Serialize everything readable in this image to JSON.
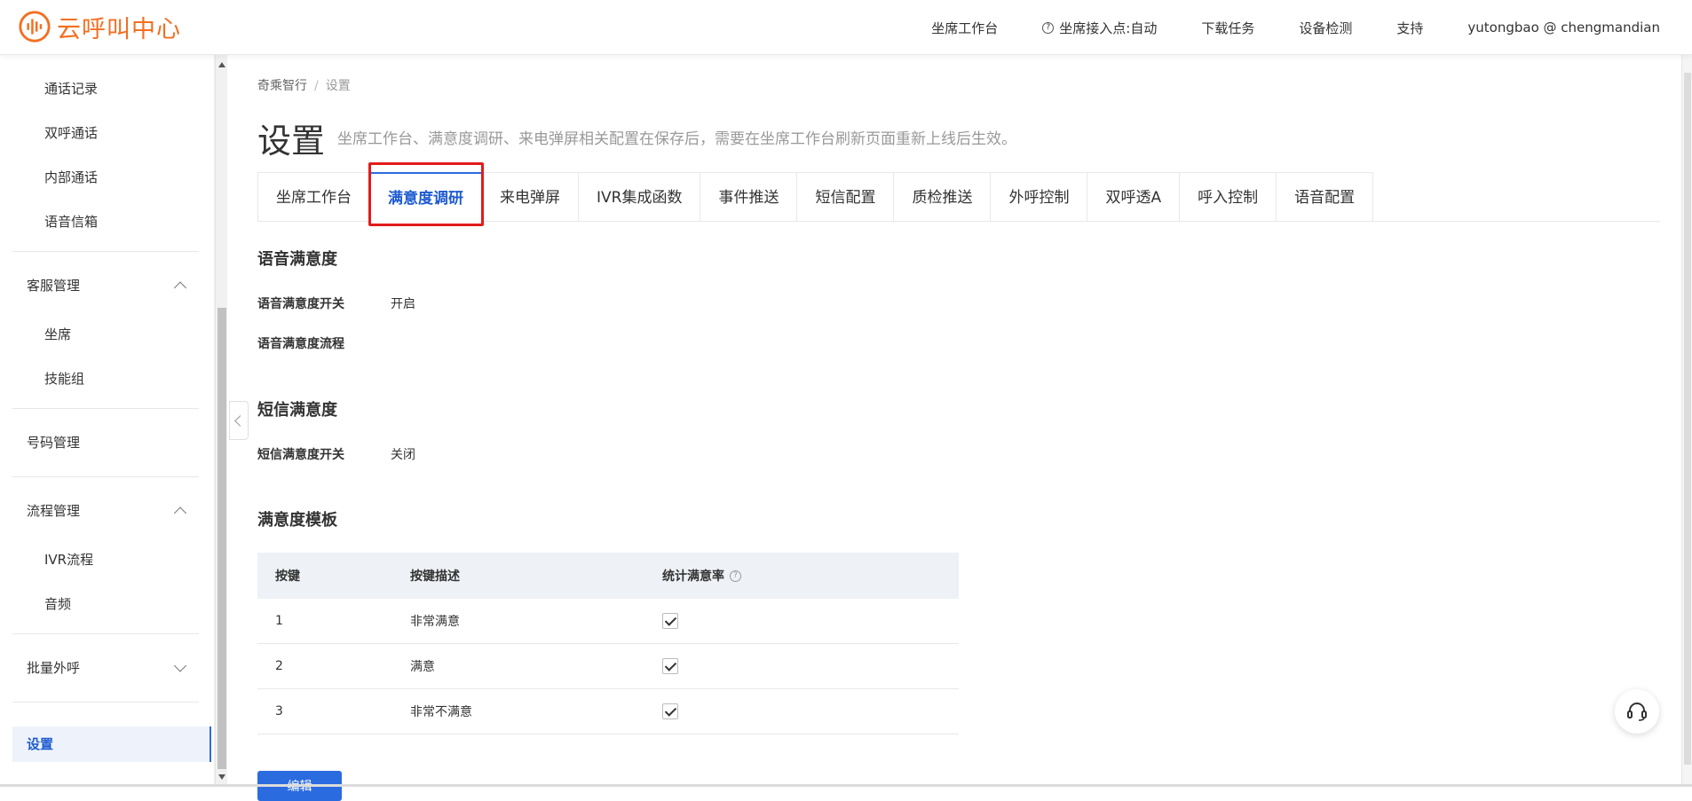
{
  "app": {
    "logo_text": "云呼叫中心"
  },
  "topnav": {
    "items": [
      "坐席工作台",
      "坐席接入点:自动",
      "下载任务",
      "设备检测",
      "支持",
      "yutongbao @ chengmandian"
    ]
  },
  "sidebar": {
    "items": [
      "通话记录",
      "双呼通话",
      "内部通话",
      "语音信箱"
    ],
    "group_service": "客服管理",
    "service_items": [
      "坐席",
      "技能组"
    ],
    "group_number": "号码管理",
    "group_flow": "流程管理",
    "flow_items": [
      "IVR流程",
      "音频"
    ],
    "group_batch": "批量外呼",
    "active": "设置"
  },
  "breadcrumb": {
    "root": "奇乘智行",
    "sep": "/",
    "current": "设置"
  },
  "page": {
    "title": "设置",
    "description": "坐席工作台、满意度调研、来电弹屏相关配置在保存后，需要在坐席工作台刷新页面重新上线后生效。"
  },
  "tabs": [
    "坐席工作台",
    "满意度调研",
    "来电弹屏",
    "IVR集成函数",
    "事件推送",
    "短信配置",
    "质检推送",
    "外呼控制",
    "双呼透A",
    "呼入控制",
    "语音配置"
  ],
  "voice_section": {
    "title": "语音满意度",
    "switch_label": "语音满意度开关",
    "switch_value": "开启",
    "flow_label": "语音满意度流程"
  },
  "sms_section": {
    "title": "短信满意度",
    "switch_label": "短信满意度开关",
    "switch_value": "关闭"
  },
  "template_section": {
    "title": "满意度模板",
    "columns": [
      "按键",
      "按键描述",
      "统计满意率"
    ],
    "rows": [
      {
        "key": "1",
        "desc": "非常满意",
        "counted": true
      },
      {
        "key": "2",
        "desc": "满意",
        "counted": true
      },
      {
        "key": "3",
        "desc": "非常不满意",
        "counted": true
      }
    ]
  },
  "edit_button": "编辑",
  "colors": {
    "brand": "#f36f21",
    "primary": "#2b6be0",
    "highlight": "#e21b1b"
  }
}
